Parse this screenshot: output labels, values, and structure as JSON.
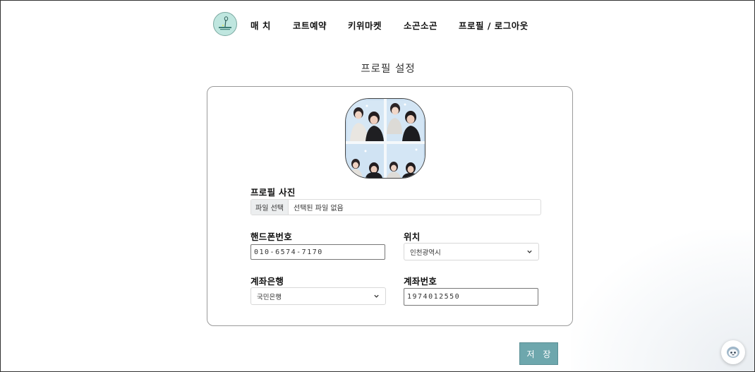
{
  "nav": {
    "logo_name": "court-logo",
    "items": [
      "매 치",
      "코트예약",
      "키위마켓",
      "소곤소곤",
      "프로필 / 로그아웃"
    ]
  },
  "page_title": "프로필 설정",
  "form": {
    "photo_label": "프로필 사진",
    "file_button": "파일 선택",
    "file_status": "선택된 파일 없음",
    "phone_label": "핸드폰번호",
    "phone_value": "010-6574-7170",
    "location_label": "위치",
    "location_value": "인천광역시",
    "bank_label": "계좌은행",
    "bank_value": "국민은행",
    "account_label": "계좌번호",
    "account_value": "1974012550"
  },
  "save_button": "저 장",
  "colors": {
    "accent": "#6ea7ad",
    "logo_bg": "#bfe6df"
  },
  "icons": [
    "chevron-down-icon",
    "chat-bot-icon"
  ]
}
